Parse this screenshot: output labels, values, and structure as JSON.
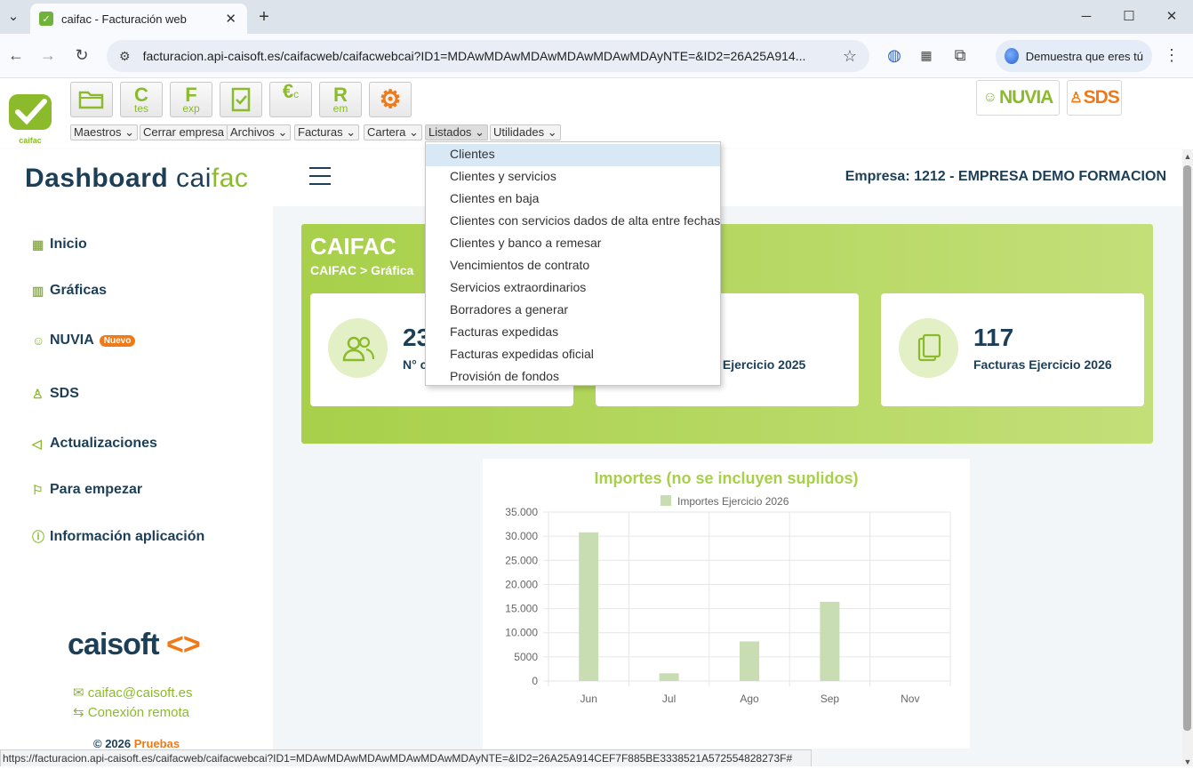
{
  "browser": {
    "tab_title": "caifac - Facturación web",
    "url": "facturacion.api-caisoft.es/caifacweb/caifacwebcai?ID1=MDAwMDAwMDAwMDAwMDAwMDAyNTE=&ID2=26A25A914...",
    "profile_label": "Demuestra que eres tú",
    "status_url": "https://facturacion.api-caisoft.es/caifacweb/caifacwebcai?ID1=MDAwMDAwMDAwMDAwMDAwMDAyNTE=&ID2=26A25A914CEF7F885BE3338521A572554828273F#"
  },
  "app": {
    "logo_text": "caifac",
    "tools": [
      {
        "top": "",
        "bottom": ""
      },
      {
        "top": "C",
        "bottom": "tes"
      },
      {
        "top": "F",
        "bottom": "exp"
      },
      {
        "top": "",
        "bottom": ""
      },
      {
        "top": "€",
        "bottom": "c"
      },
      {
        "top": "R",
        "bottom": "em"
      },
      {
        "top": "",
        "bottom": ""
      }
    ],
    "menus": [
      "Maestros",
      "Cerrar empresa",
      "Archivos",
      "Facturas",
      "Cartera",
      "Listados",
      "Utilidades"
    ],
    "nuvia_btn": "NUVIA",
    "sds_btn": "SDS"
  },
  "dashboard": {
    "title_a": "Dashboard ",
    "title_b": "cai",
    "title_c": "fac",
    "empresa": "Empresa: 1212 - EMPRESA DEMO FORMACION"
  },
  "sidebar": {
    "items": [
      "Inicio",
      "Gráficas",
      "NUVIA",
      "SDS",
      "Actualizaciones",
      "Para empezar",
      "Información aplicación"
    ],
    "badge": "Nuevo",
    "brand": "caisoft",
    "email": "caifac@caisoft.es",
    "remote": "Conexión remota",
    "copyright": "© 2026",
    "copyright_link": "Pruebas"
  },
  "hero": {
    "title": "CAIFAC",
    "breadcrumb": "CAIFAC  >  Gráfica",
    "cards": [
      {
        "number": "23",
        "label": "N° c"
      },
      {
        "number": "",
        "label": "ras Ejercicio 2025"
      },
      {
        "number": "117",
        "label": "Facturas Ejercicio 2026"
      }
    ]
  },
  "listados_menu": [
    "Clientes",
    "Clientes y servicios",
    "Clientes en baja",
    "Clientes con servicios dados de alta entre fechas",
    "Clientes y banco a remesar",
    "Vencimientos de contrato",
    "Servicios extraordinarios",
    "Borradores a generar",
    "Facturas expedidas",
    "Facturas expedidas oficial",
    "Provisión de fondos"
  ],
  "colors": {
    "accent": "#8bbb2a",
    "navy": "#1c3f57",
    "orange": "#f07a17",
    "bar": "#c9ddb3"
  },
  "chart_data": {
    "type": "bar",
    "title": "Importes (no se incluyen suplidos)",
    "categories": [
      "Jun",
      "Jul",
      "Ago",
      "Sep",
      "Nov"
    ],
    "series": [
      {
        "name": "Importes Ejercicio 2026",
        "values": [
          30800,
          1600,
          8200,
          16400,
          0
        ]
      }
    ],
    "ylim": [
      0,
      35000
    ],
    "yticks": [
      "35.000",
      "30.000",
      "25.000",
      "20.000",
      "15.000",
      "10.000",
      "5000",
      "0"
    ],
    "grid": true,
    "legend": "top"
  }
}
